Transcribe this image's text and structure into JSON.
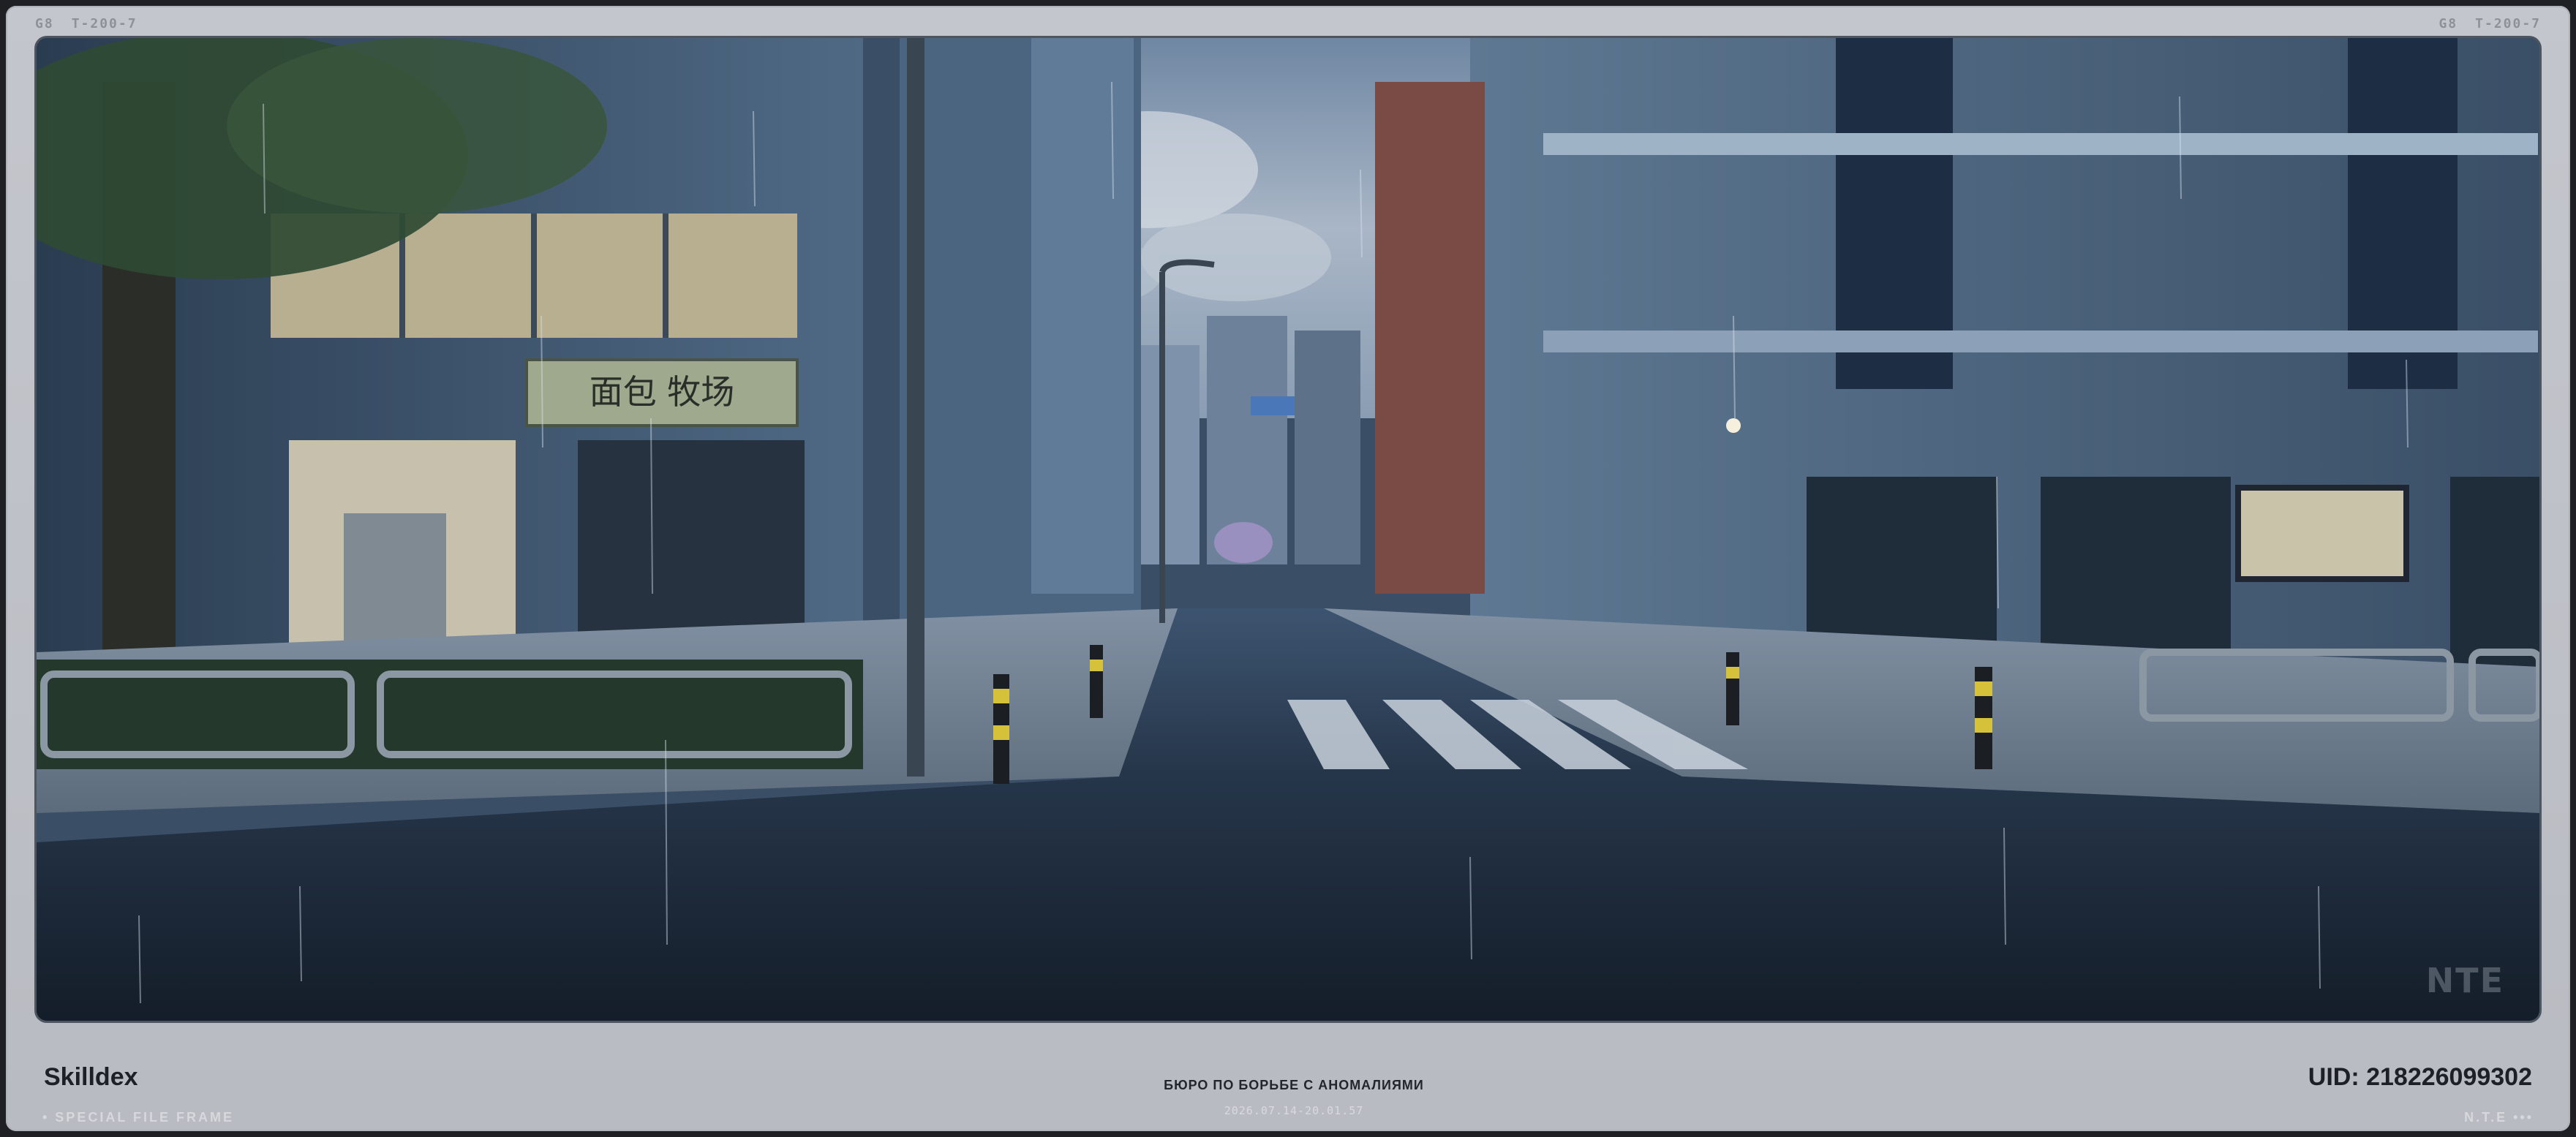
{
  "header": {
    "left_codes": [
      "G8",
      "T-200-7"
    ],
    "right_codes": [
      "G8",
      "T-200-7"
    ]
  },
  "scene": {
    "description_icon": "rainy-street-photo",
    "shop_sign": "面包 牧场",
    "watermark": "NTE"
  },
  "footer": {
    "brand": "Skilldex",
    "subtag": "• SPECIAL FILE FRAME",
    "department": "БЮРО ПО БОРЬБЕ С АНОМАЛИЯМИ",
    "timestamp": "2026.07.14-20.01.57",
    "uid": "UID: 218226099302",
    "right_tag": "N.T.E •••"
  },
  "colors": {
    "frame": "#c0c3c9",
    "text_dark": "#1d2026",
    "text_faint": "#d6d8dc"
  }
}
